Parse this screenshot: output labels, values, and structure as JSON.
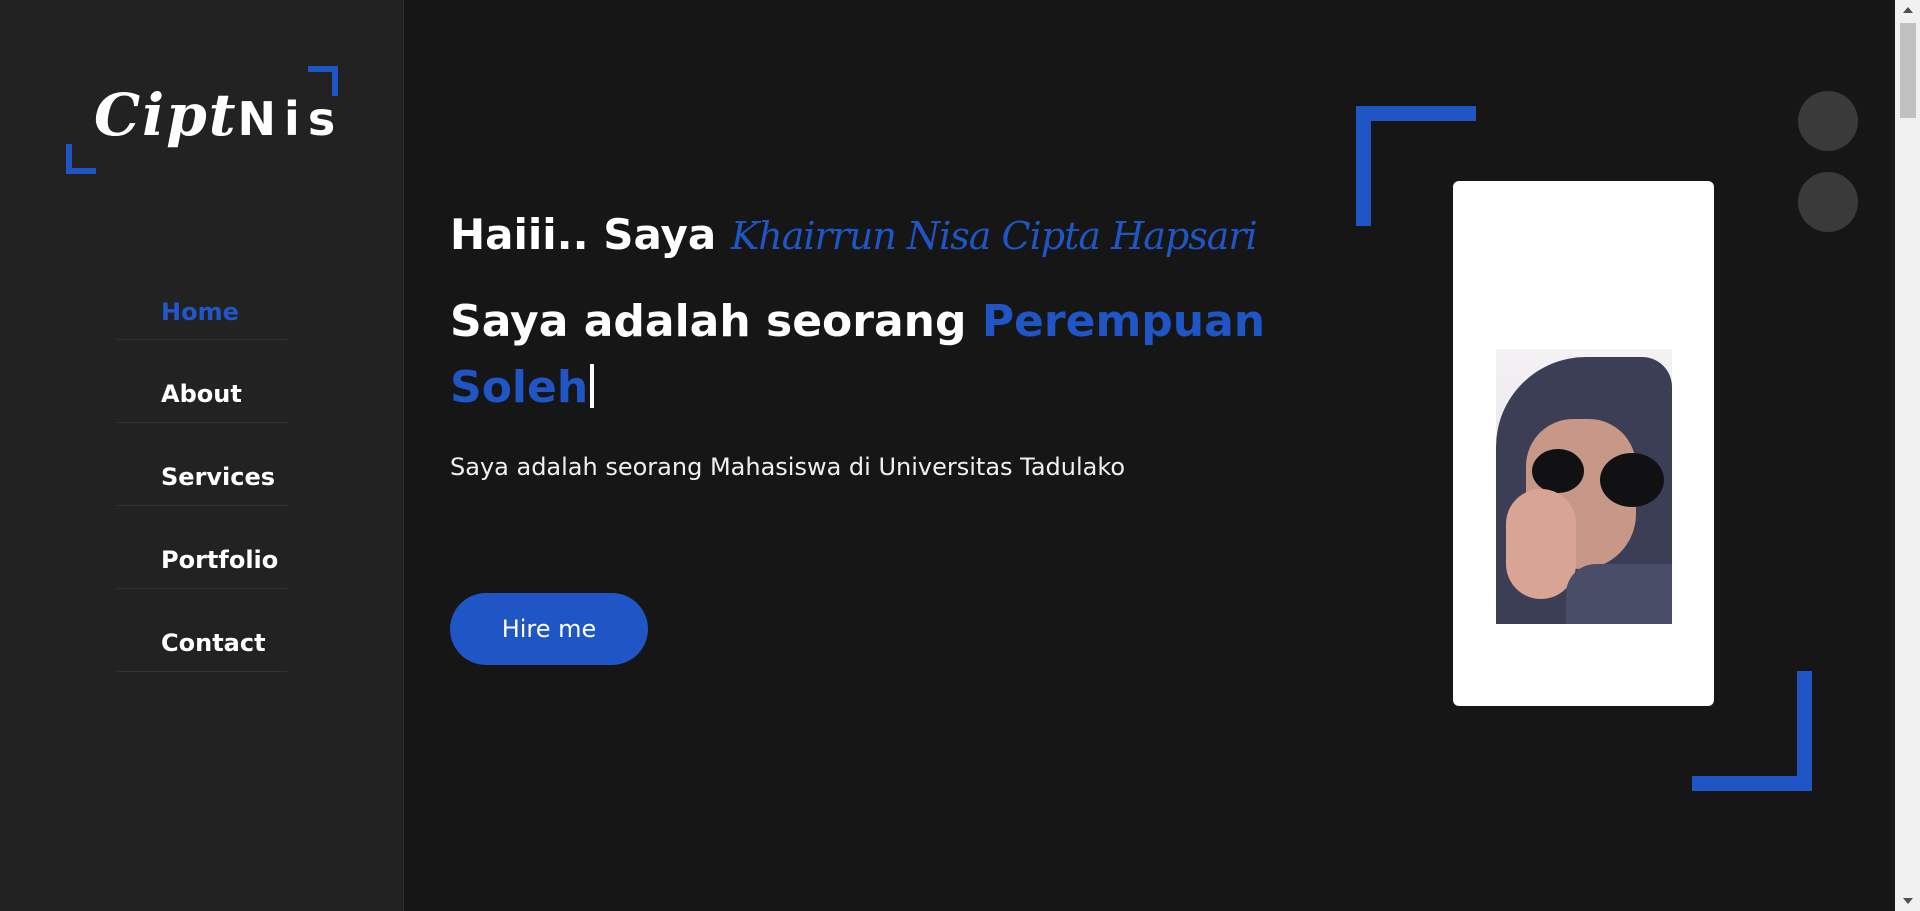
{
  "brand": {
    "logo_script": "Cipt",
    "logo_bold": "Nis"
  },
  "nav": {
    "items": [
      {
        "label": "Home",
        "active": true
      },
      {
        "label": "About",
        "active": false
      },
      {
        "label": "Services",
        "active": false
      },
      {
        "label": "Portfolio",
        "active": false
      },
      {
        "label": "Contact",
        "active": false
      }
    ]
  },
  "hero": {
    "greeting": "Haiii.. Saya",
    "name": "Khairrun Nisa Cipta Hapsari",
    "headline_prefix": "Saya adalah seorang",
    "headline_accent": "Perempuan Soleh",
    "description": "Saya adalah seorang Mahasiswa di Universitas Tadulako",
    "cta_label": "Hire me"
  },
  "theme": {
    "accent": "#1f55c4",
    "background": "#161616",
    "sidebar": "#222222"
  },
  "icons": {
    "photo": "profile-photo",
    "toggle_dots": [
      "theme-dot",
      "theme-dot"
    ]
  }
}
